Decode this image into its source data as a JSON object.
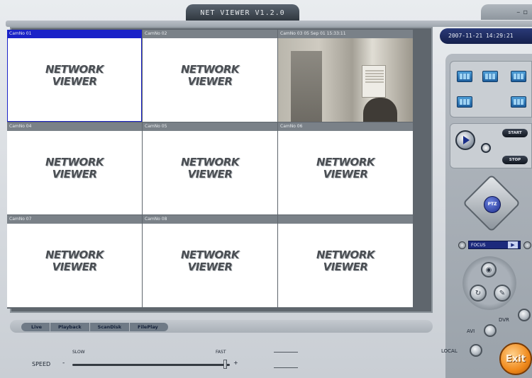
{
  "window": {
    "title": "NET VIEWER V1.2.0",
    "minimize_glyph": "–",
    "restore_glyph": "▫"
  },
  "datetime": "2007-11-21  14:29:21",
  "cells": [
    {
      "header": "CamNo 01",
      "logo_line1": "NETWORK",
      "logo_line2": "VIEWER",
      "active": true,
      "live": false
    },
    {
      "header": "CamNo 02",
      "logo_line1": "NETWORK",
      "logo_line2": "VIEWER",
      "active": false,
      "live": false
    },
    {
      "header": "CamNo 03 05 Sep 01 15:33:11",
      "logo_line1": "",
      "logo_line2": "",
      "active": false,
      "live": true
    },
    {
      "header": "CamNo 04",
      "logo_line1": "NETWORK",
      "logo_line2": "VIEWER",
      "active": false,
      "live": false
    },
    {
      "header": "CamNo 05",
      "logo_line1": "NETWORK",
      "logo_line2": "VIEWER",
      "active": false,
      "live": false
    },
    {
      "header": "CamNo 06",
      "logo_line1": "NETWORK",
      "logo_line2": "VIEWER",
      "active": false,
      "live": false
    },
    {
      "header": "CamNo 07",
      "logo_line1": "NETWORK",
      "logo_line2": "VIEWER",
      "active": false,
      "live": false
    },
    {
      "header": "CamNo 08",
      "logo_line1": "NETWORK",
      "logo_line2": "VIEWER",
      "active": false,
      "live": false
    },
    {
      "header": "",
      "logo_line1": "NETWORK",
      "logo_line2": "VIEWER",
      "active": false,
      "live": false
    }
  ],
  "tabs": [
    "Live",
    "Playback",
    "ScanDisk",
    "FilePlay"
  ],
  "speed": {
    "label": "SPEED",
    "slow_label": "SLOW",
    "fast_label": "FAST",
    "minus": "-",
    "plus": "+",
    "value_fraction": 0.98
  },
  "record": {
    "start_label": "START",
    "stop_label": "STOP"
  },
  "ptz": {
    "center_label": "PTZ",
    "focus_value": "FOCUS",
    "focus_arrow": "▶"
  },
  "modes": {
    "avi_label": "AVI",
    "dvr_label": "DVR",
    "local_label": "LOCAL"
  },
  "exit_label": "Exit",
  "colors": {
    "accent_blue": "#1a22c8",
    "exit_orange": "#f08a1c",
    "cell_header": "#7a8188"
  }
}
